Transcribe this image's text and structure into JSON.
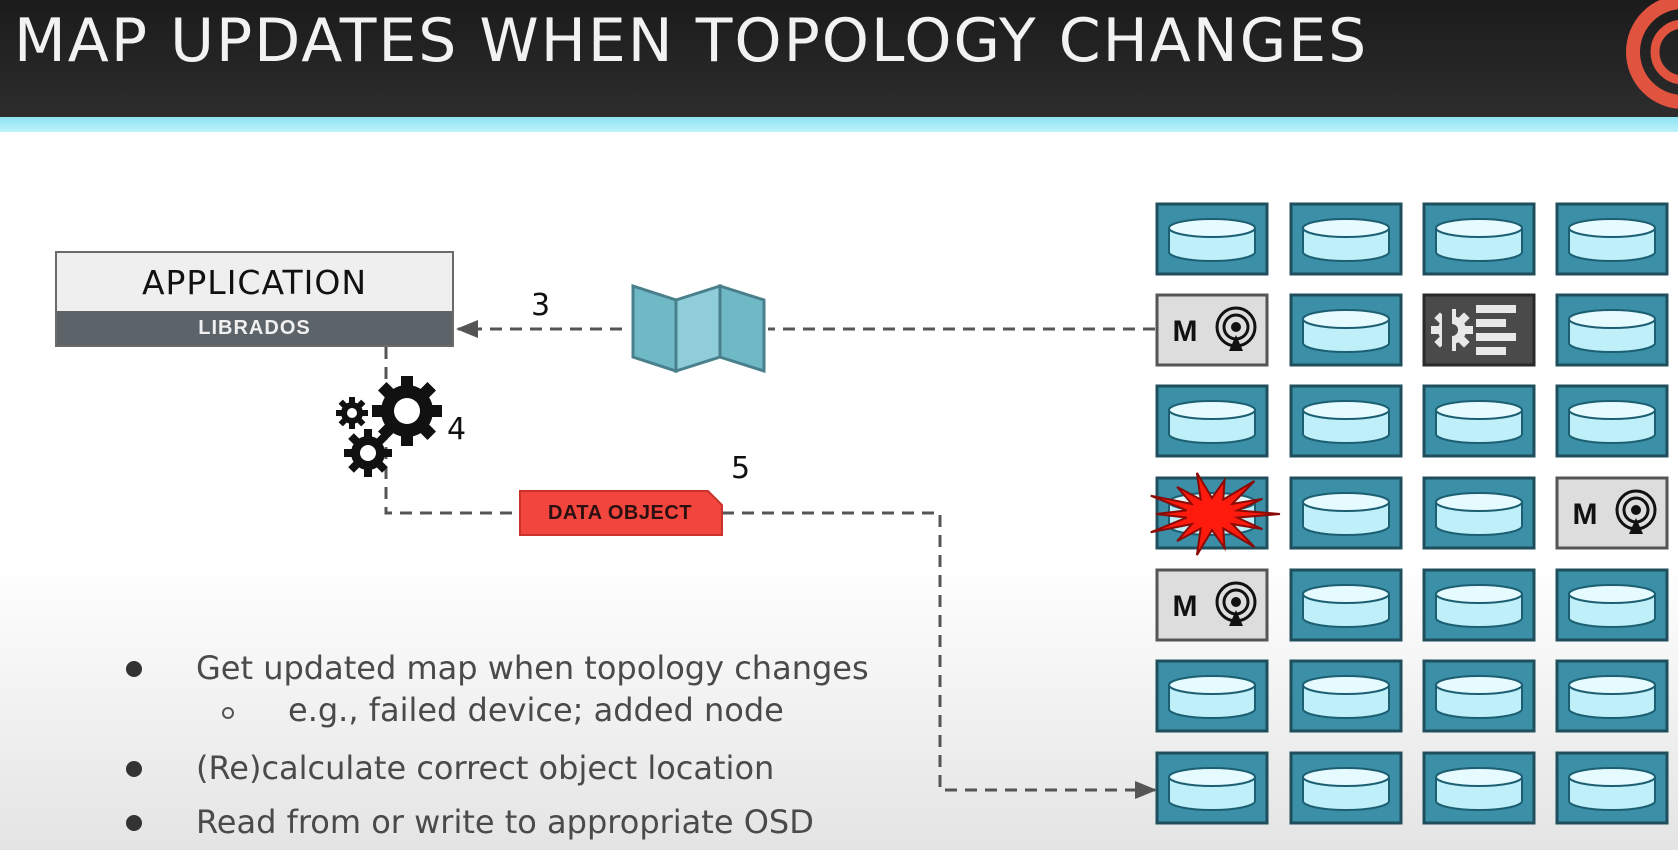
{
  "title": "MAP UPDATES WHEN TOPOLOGY CHANGES",
  "application": {
    "label": "APPLICATION",
    "library": "LIBRADOS"
  },
  "steps": {
    "map": "3",
    "compute": "4",
    "write": "5"
  },
  "data_object": "DATA OBJECT",
  "bullets": [
    {
      "text": "Get updated map when topology changes",
      "sub": "e.g., failed device; added node"
    },
    {
      "text": "(Re)calculate correct object location"
    },
    {
      "text": "Read from or write to appropriate OSD"
    }
  ],
  "cluster": {
    "rows": [
      [
        "osd",
        "osd",
        "osd",
        "osd"
      ],
      [
        "monitor",
        "osd",
        "manager",
        "osd"
      ],
      [
        "osd",
        "osd",
        "osd",
        "osd"
      ],
      [
        "failed-osd",
        "osd",
        "osd",
        "monitor"
      ],
      [
        "monitor",
        "osd",
        "osd",
        "osd"
      ],
      [
        "osd",
        "osd",
        "osd",
        "osd"
      ],
      [
        "osd",
        "osd",
        "osd",
        "osd"
      ]
    ],
    "monitor_label": "M"
  },
  "icons": {
    "map": "folded-map-icon",
    "gears": "gears-icon",
    "osd": "disk-icon",
    "monitor": "broadcast-icon",
    "manager": "manager-icon",
    "failure": "explosion-icon"
  },
  "colors": {
    "osd_frame": "#3b8fa6",
    "osd_disk": "#bfeff8",
    "data_object": "#f2453d",
    "failure": "#ff1a0e",
    "title_bar": "#222222",
    "accent_strip": "#9ee8f5"
  }
}
